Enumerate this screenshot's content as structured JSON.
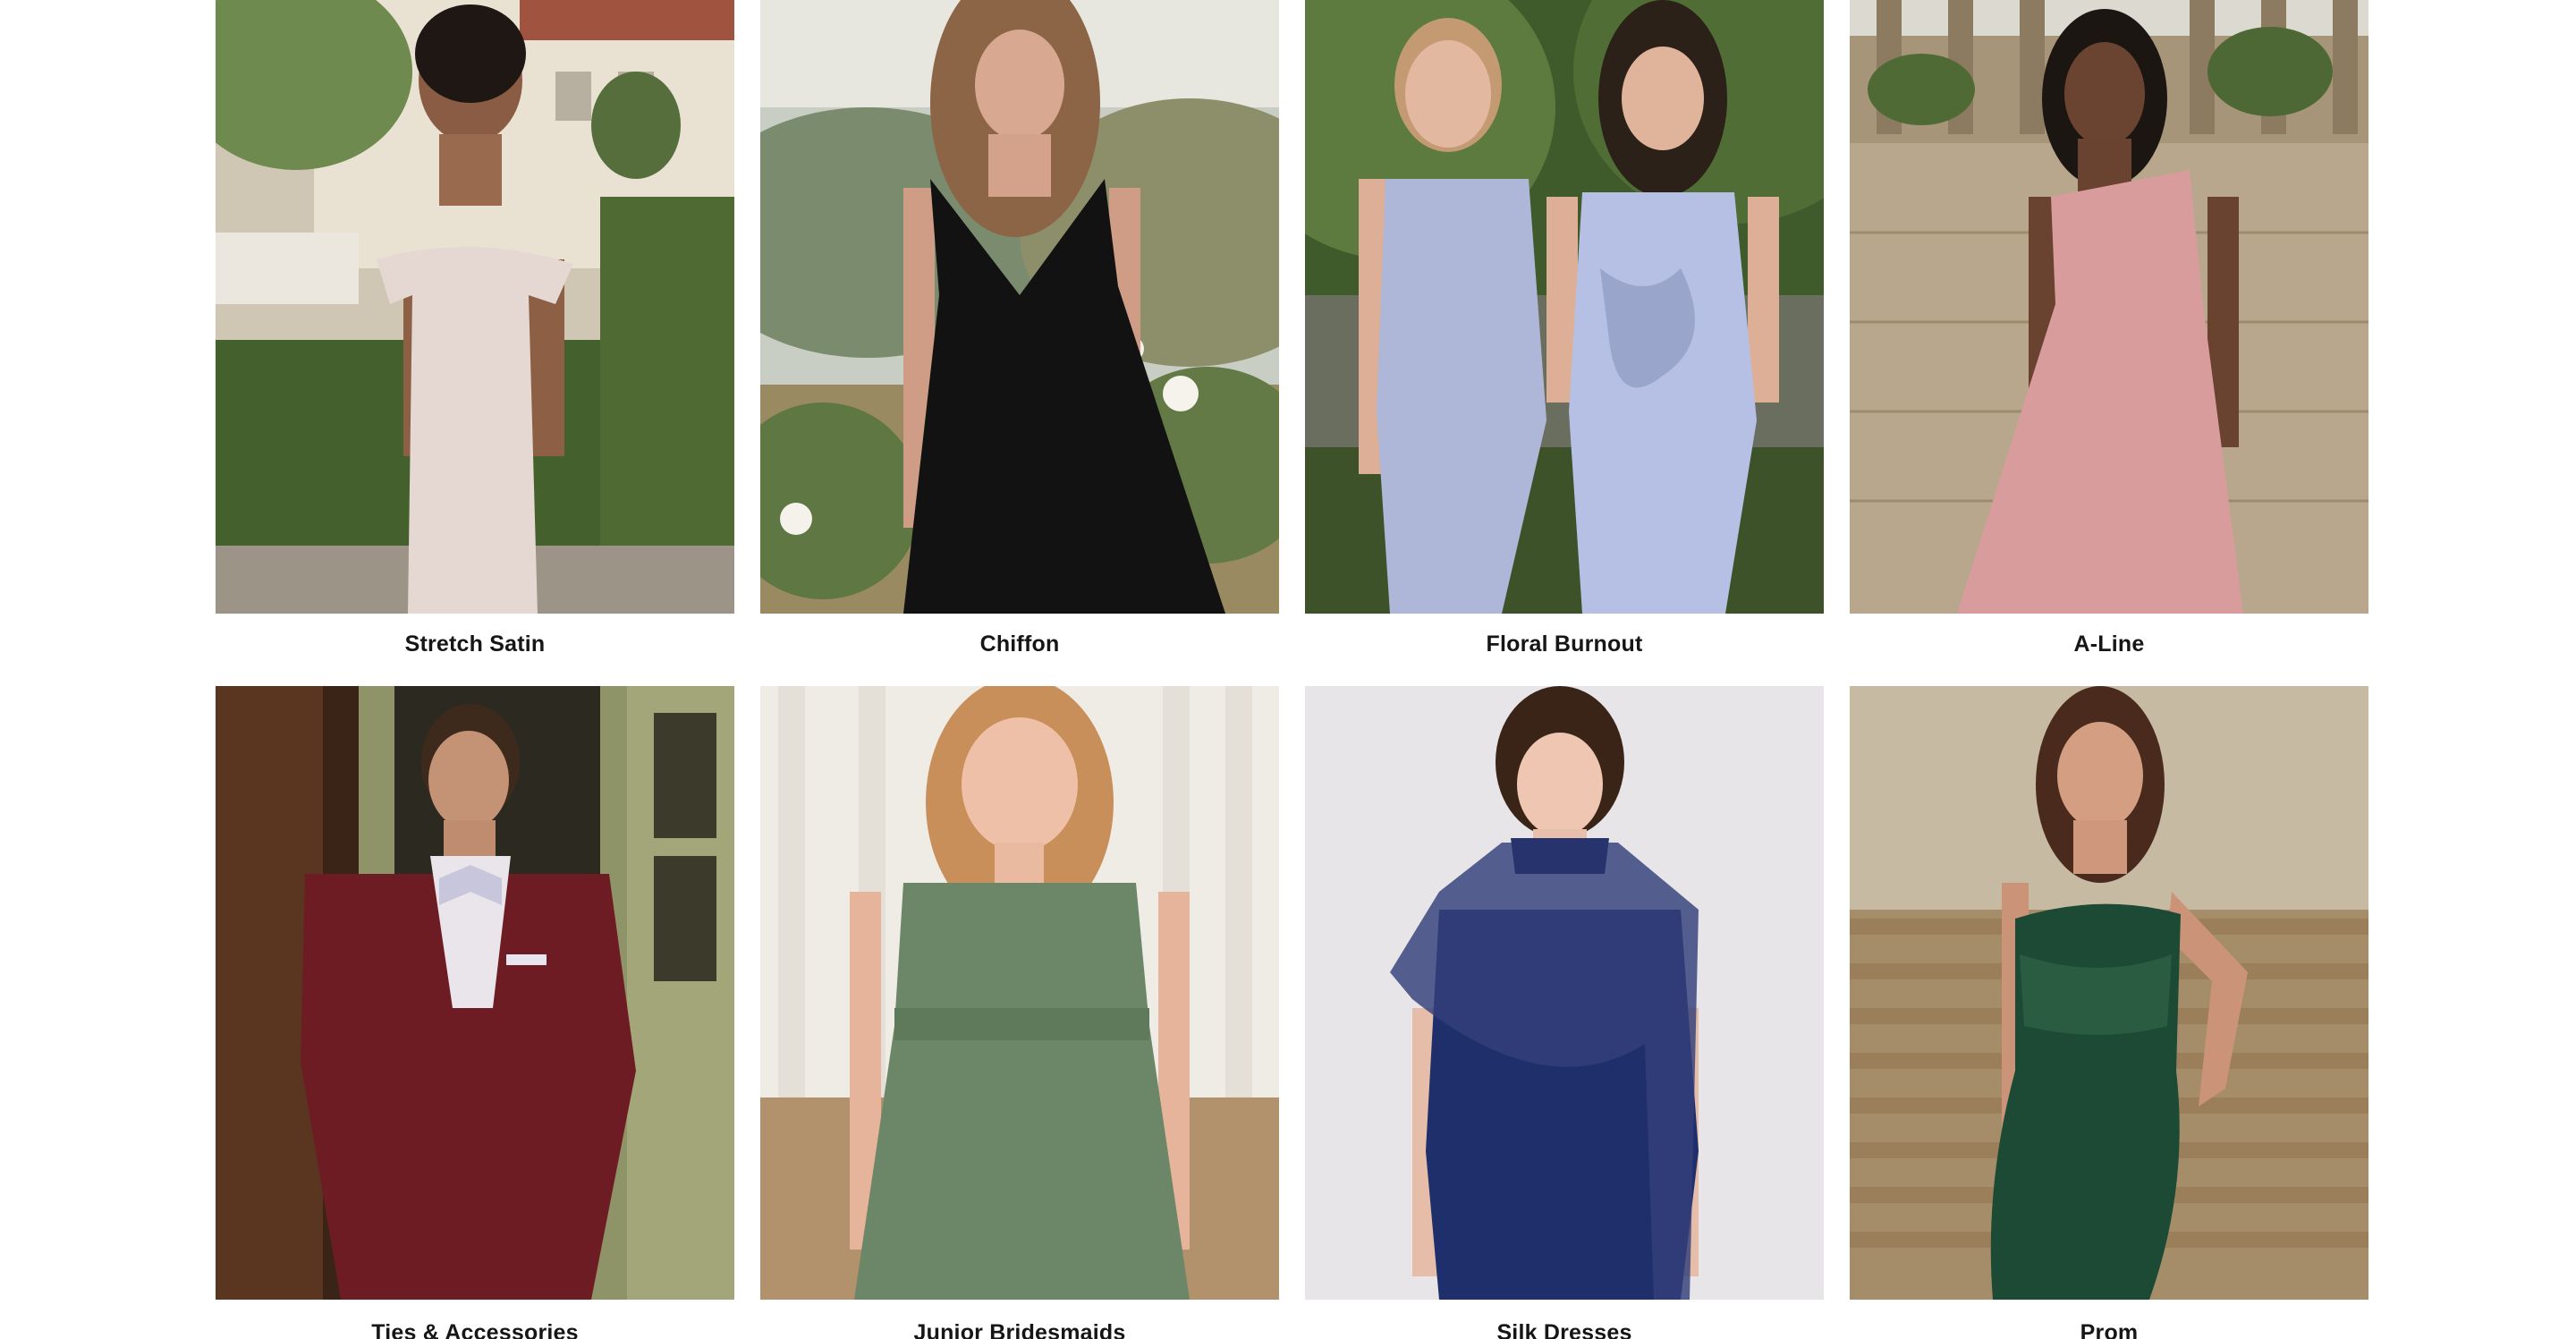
{
  "categories": [
    {
      "label": "Stretch Satin",
      "image": "model in blush off-shoulder satin gown in garden"
    },
    {
      "label": "Chiffon",
      "image": "model in black pleated chiffon gown with flowers"
    },
    {
      "label": "Floral Burnout",
      "image": "two models in periwinkle gowns"
    },
    {
      "label": "A-Line",
      "image": "model in pink one-shoulder a-line gown by stone balustrade"
    },
    {
      "label": "Ties & Accessories",
      "image": "man in burgundy three-piece suit with lilac bow tie"
    },
    {
      "label": "Junior Bridesmaids",
      "image": "girl in sage green halter chiffon dress"
    },
    {
      "label": "Silk Dresses",
      "image": "model in navy satin dress with chiffon cape"
    },
    {
      "label": "Prom",
      "image": "model in emerald sequin strapless gown on steps"
    }
  ],
  "colors": {
    "label_text": "#161616",
    "background": "#ffffff"
  }
}
